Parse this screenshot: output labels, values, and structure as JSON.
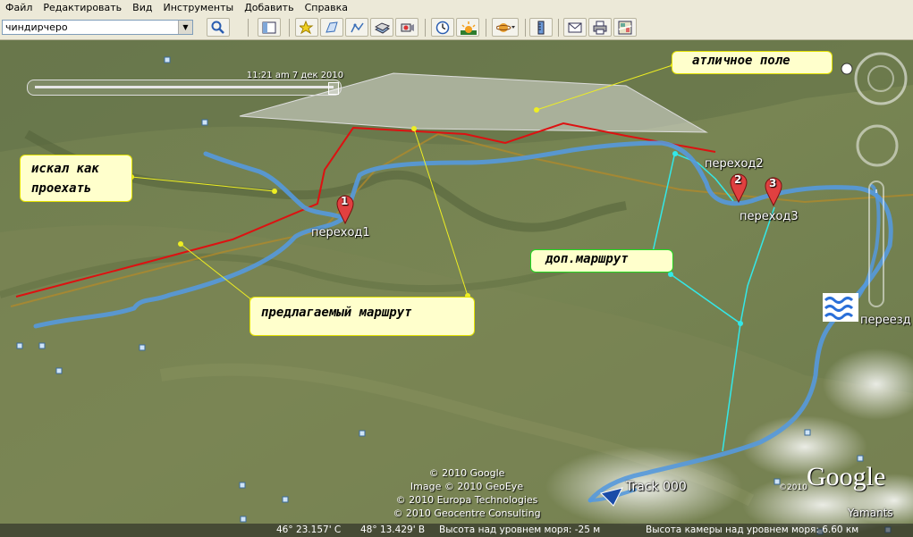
{
  "menu": [
    "Файл",
    "Редактировать",
    "Вид",
    "Инструменты",
    "Добавить",
    "Справка"
  ],
  "search": {
    "value": "чиндирчеро"
  },
  "toolbar_icons": [
    "sidebar-icon",
    "placemark-icon",
    "polygon-icon",
    "path-icon",
    "overlay-icon",
    "record-tour-icon",
    "historical-imagery-icon",
    "sunlight-icon",
    "planet-icon",
    "ruler-icon",
    "email-icon",
    "print-icon",
    "view-in-maps-icon"
  ],
  "time_slider": {
    "label": "11:21 am  7 дек 2010"
  },
  "callouts": {
    "field": "атличное поле",
    "searched": "искал как\nпроехать",
    "proposed": "предлагаемый маршрут",
    "extra": "доп.маршрут"
  },
  "placemarks": [
    {
      "number": "1",
      "label": "переход1"
    },
    {
      "number": "2",
      "label": "переход2"
    },
    {
      "number": "3",
      "label": "переход3"
    }
  ],
  "ford_label": "переезд",
  "track_label": "Track 000",
  "credits": [
    "© 2010 Google",
    "Image © 2010 GeoEye",
    "© 2010 Europa Technologies",
    "© 2010 Geocentre Consulting"
  ],
  "logo": {
    "text": "Google",
    "year": "©2010"
  },
  "place_label": "Yamants",
  "statusbar": {
    "lat": "46° 23.157' С",
    "lon": "48° 13.429' В",
    "elevation": "Высота над уровнем моря:  -25 м",
    "camera": "Высота камеры над уровнем моря:   6.60 км"
  },
  "colors": {
    "track": "#5599dd",
    "proposed": "#dd1111",
    "extra": "#33e8e8",
    "callout_line": "#eeee22"
  }
}
